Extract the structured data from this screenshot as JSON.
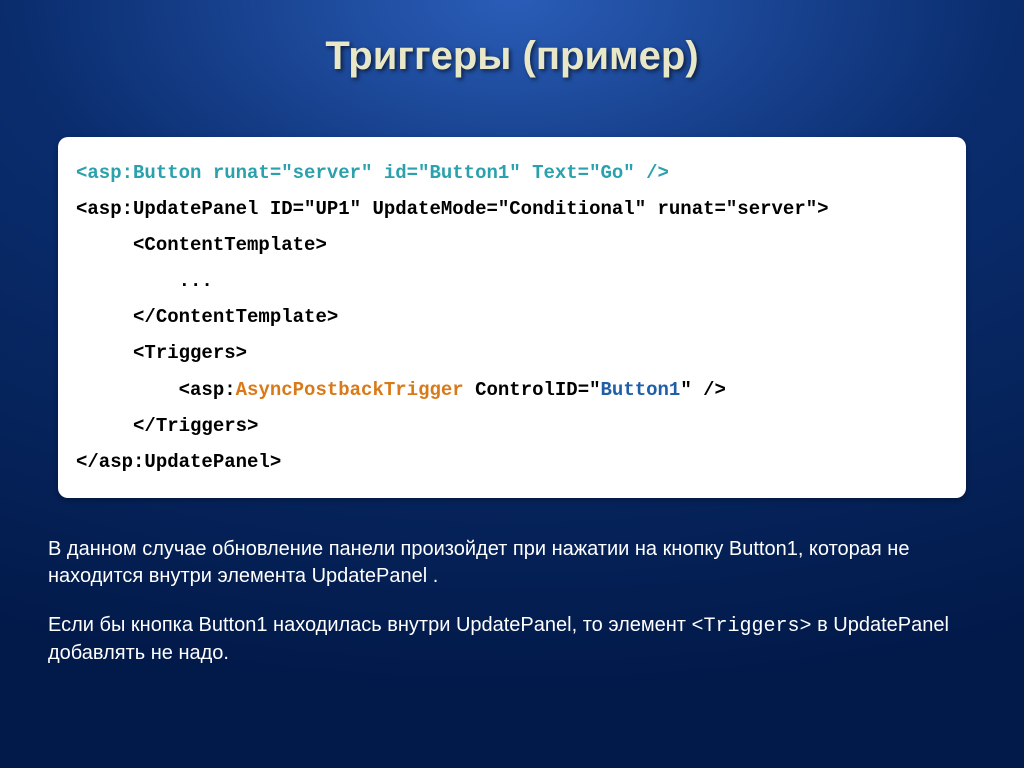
{
  "title": "Триггеры (пример)",
  "code": {
    "l1": "<asp:Button runat=\"server\" id=\"Button1\" Text=\"Go\" />",
    "l2": "<asp:UpdatePanel ID=\"UP1\" UpdateMode=\"Conditional\" runat=\"server\">",
    "l3": "     <ContentTemplate>",
    "l4": "         ...",
    "l5": "     </ContentTemplate>",
    "l6": "     <Triggers>",
    "l7a": "         <asp:",
    "l7b": "AsyncPostbackTrigger",
    "l7c": " ControlID=\"",
    "l7d": "Button1",
    "l7e": "\" />",
    "l8": "     </Triggers>",
    "l9": "</asp:UpdatePanel>"
  },
  "para1": "В данном случае обновление панели произойдет при нажатии на кнопку Button1, которая не  находится внутри элемента UpdatePanel .",
  "para2_a": "Если бы кнопка Button1 находилась внутри UpdatePanel, то элемент ",
  "para2_code": "<Triggers>",
  "para2_b": "  в UpdatePanel добавлять не надо."
}
